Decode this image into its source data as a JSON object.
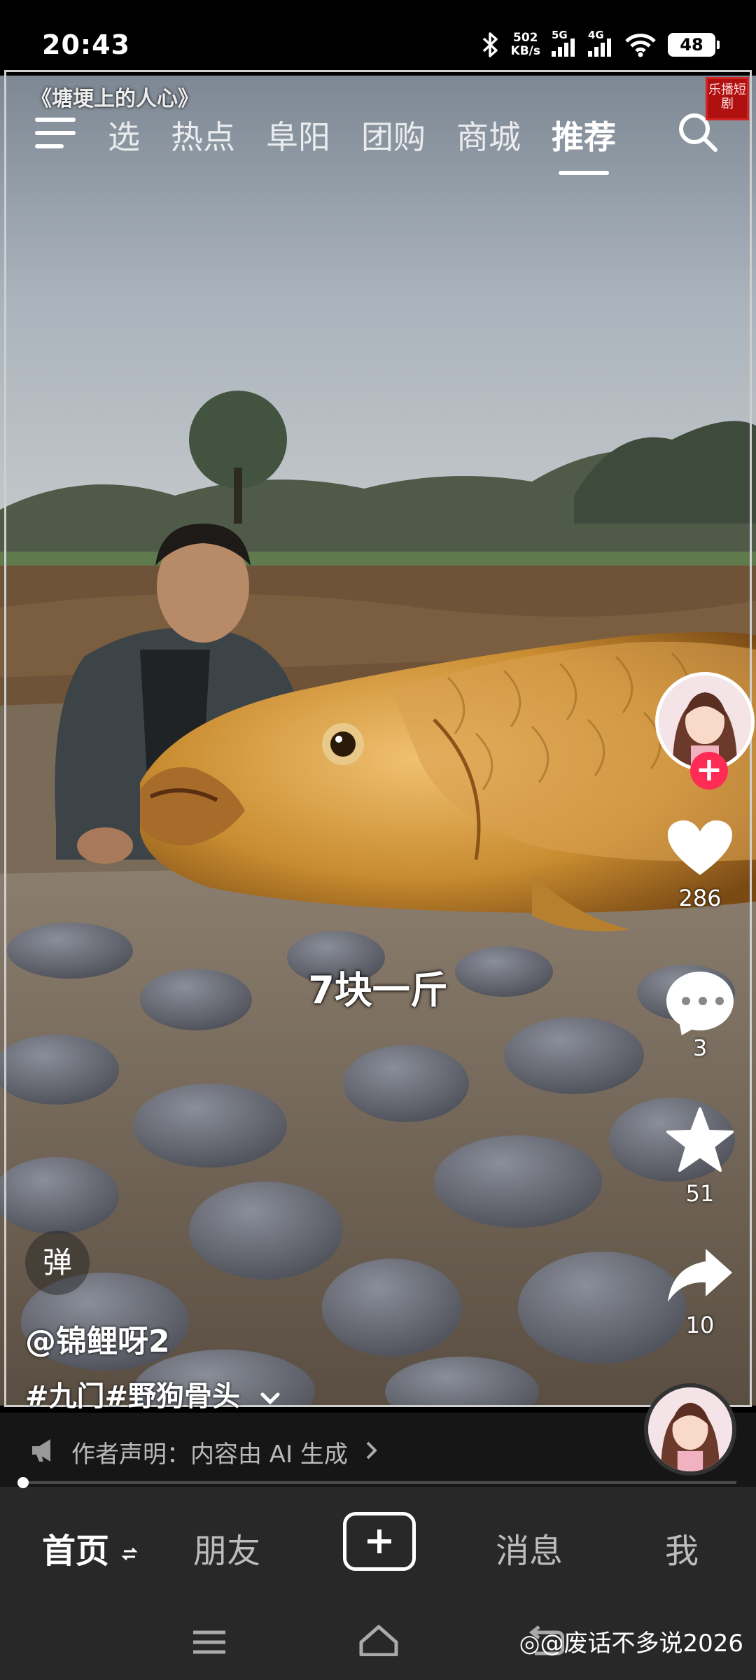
{
  "status_bar": {
    "time": "20:43",
    "net_speed_value": "502",
    "net_speed_unit": "KB/s",
    "signal_1_label": "5G",
    "signal_2_label": "4G",
    "battery": "48",
    "icons": [
      "bluetooth-icon",
      "signal-icon",
      "wifi-icon",
      "battery-icon"
    ]
  },
  "video": {
    "overlay_title": "《塘埂上的人心》",
    "stamp_text": "乐播短剧",
    "caption": "7块一斤"
  },
  "top_nav": {
    "tabs": [
      {
        "label": "精选"
      },
      {
        "label": "热点"
      },
      {
        "label": "阜阳"
      },
      {
        "label": "团购"
      },
      {
        "label": "商城"
      },
      {
        "label": "推荐"
      }
    ],
    "active_tab": "推荐"
  },
  "actions": {
    "likes": "286",
    "comments": "3",
    "favorites": "51",
    "shares": "10"
  },
  "post": {
    "danmaku_label": "弹",
    "author": "@锦鲤呀2",
    "hashtags": "#九门#野狗骨头",
    "ai_notice": "作者声明：内容由 AI 生成"
  },
  "progress": {
    "fraction": 0.005
  },
  "bottom_tabs": {
    "home": "首页",
    "friends": "朋友",
    "messages": "消息",
    "me": "我"
  },
  "watermark": "@废话不多说2026",
  "colors": {
    "accent": "#fe2c55",
    "tabbar_bg": "#282828"
  }
}
